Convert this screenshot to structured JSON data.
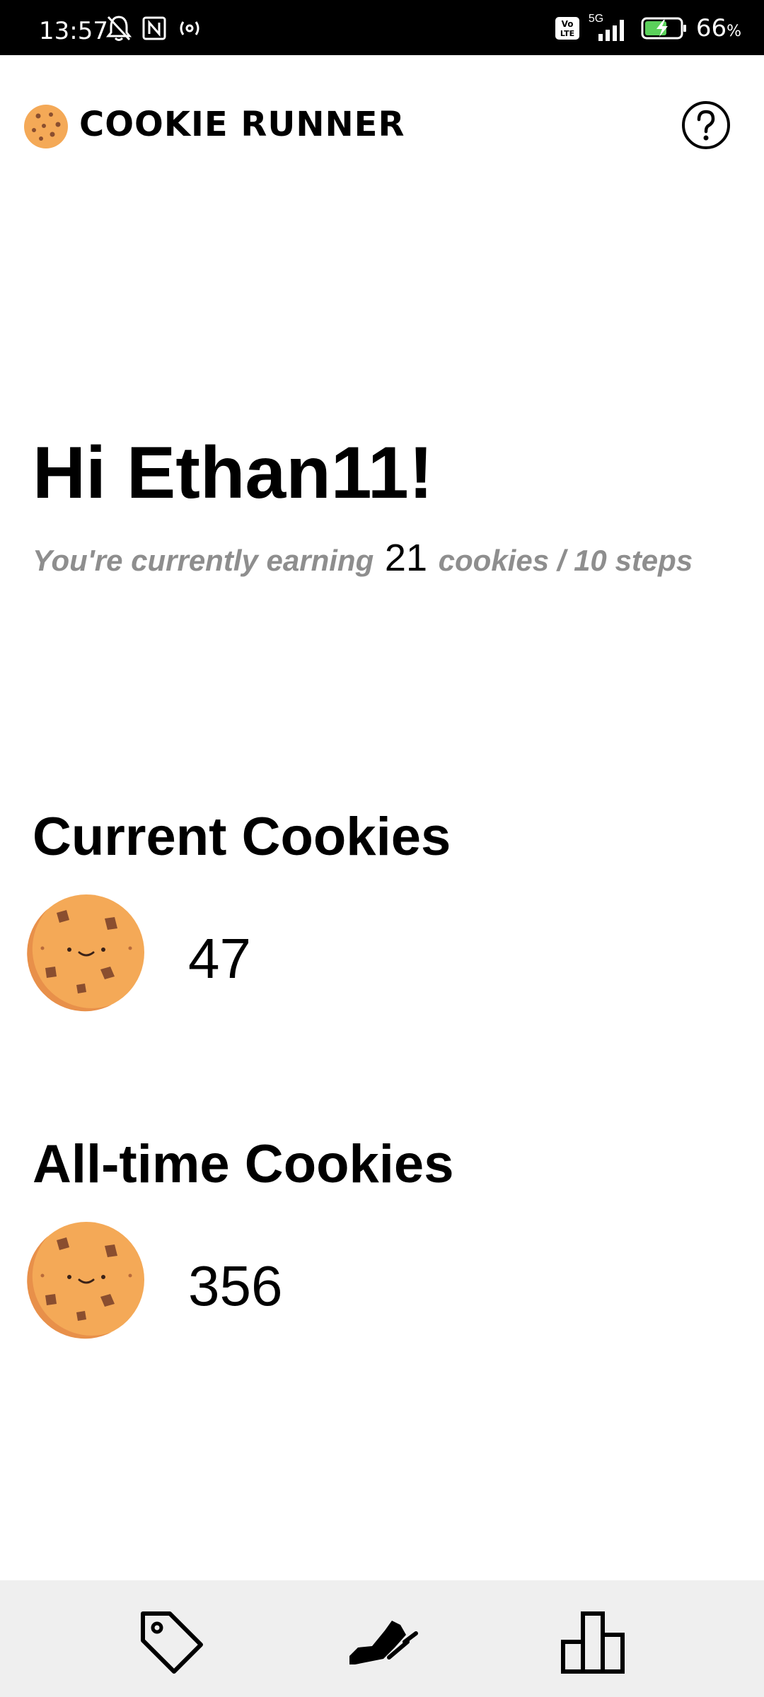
{
  "status_bar": {
    "time": "13:57",
    "network": "5G",
    "volte": "Vo LTE",
    "battery_text": "66",
    "battery_unit": "%"
  },
  "app": {
    "title": "COOKIE RUNNER"
  },
  "user": {
    "greeting": "Hi Ethan11!",
    "earning_prefix": "You're currently earning",
    "earning_rate": "21",
    "earning_suffix": "cookies / 10 steps"
  },
  "current": {
    "title": "Current Cookies",
    "count": "47"
  },
  "alltime": {
    "title": "All-time Cookies",
    "count": "356"
  },
  "icons": {
    "help": "help-circle-icon",
    "nav_1": "tag-icon",
    "nav_2": "shoe-icon",
    "nav_3": "leaderboard-icon"
  },
  "colors": {
    "cookie": "#f4a957",
    "cookie_shade": "#e8904a",
    "chip": "#8a4e2f",
    "nav_bg": "#efefef"
  }
}
